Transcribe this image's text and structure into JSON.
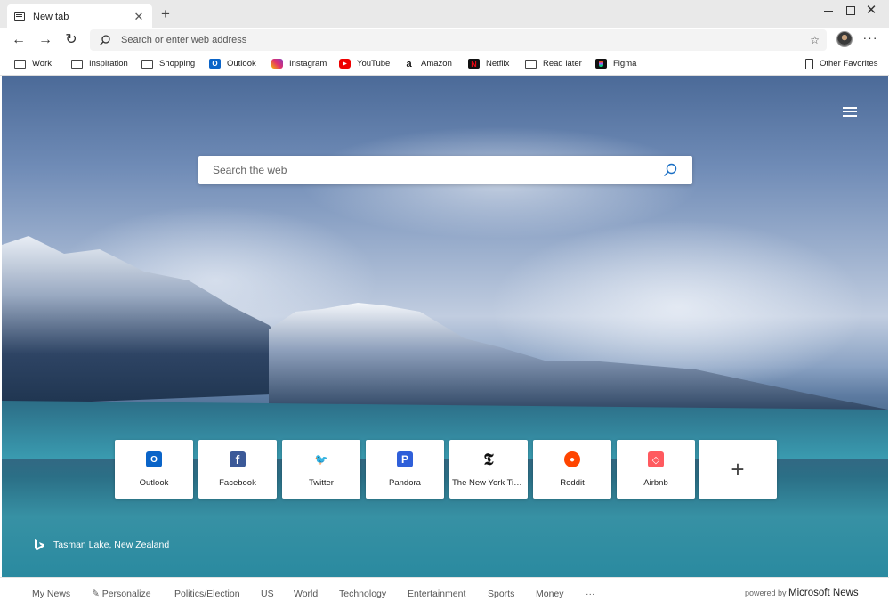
{
  "tab": {
    "title": "New tab",
    "close": "✕",
    "new_tab": "+"
  },
  "window": {
    "minimize": "",
    "maximize": "",
    "close": "✕"
  },
  "toolbar": {
    "back": "←",
    "forward": "→",
    "refresh": "↻",
    "address_placeholder": "Search or enter web address",
    "favorite_star": "☆",
    "more": "···"
  },
  "favorites": {
    "items": [
      {
        "label": "Work",
        "icon": "folder-icon"
      },
      {
        "label": "Inspiration",
        "icon": "folder-icon"
      },
      {
        "label": "Shopping",
        "icon": "folder-icon"
      },
      {
        "label": "Outlook",
        "icon": "outlook-icon"
      },
      {
        "label": "Instagram",
        "icon": "instagram-icon"
      },
      {
        "label": "YouTube",
        "icon": "youtube-icon"
      },
      {
        "label": "Amazon",
        "icon": "amazon-icon"
      },
      {
        "label": "Netflix",
        "icon": "netflix-icon"
      },
      {
        "label": "Read later",
        "icon": "folder-icon"
      },
      {
        "label": "Figma",
        "icon": "figma-icon"
      }
    ],
    "other": "Other Favorites"
  },
  "newtab": {
    "search_placeholder": "Search the web",
    "tiles": [
      {
        "label": "Outlook",
        "glyph": "O"
      },
      {
        "label": "Facebook",
        "glyph": "f"
      },
      {
        "label": "Twitter",
        "glyph": "🐦"
      },
      {
        "label": "Pandora",
        "glyph": "P"
      },
      {
        "label": "The New York Times",
        "glyph": "𝕿"
      },
      {
        "label": "Reddit",
        "glyph": "●"
      },
      {
        "label": "Airbnb",
        "glyph": "◇"
      }
    ],
    "add_tile": "+",
    "location": "Tasman Lake, New Zealand"
  },
  "news": {
    "items": [
      "My News",
      "Personalize",
      "Politics/Election",
      "US",
      "World",
      "Technology",
      "Entertainment",
      "Sports",
      "Money",
      "···"
    ],
    "powered_by": "powered by",
    "brand": "Microsoft News"
  },
  "colors": {
    "accent": "#0a64c8",
    "sky": "#6f8bb6",
    "lake": "#2a8aa0"
  }
}
